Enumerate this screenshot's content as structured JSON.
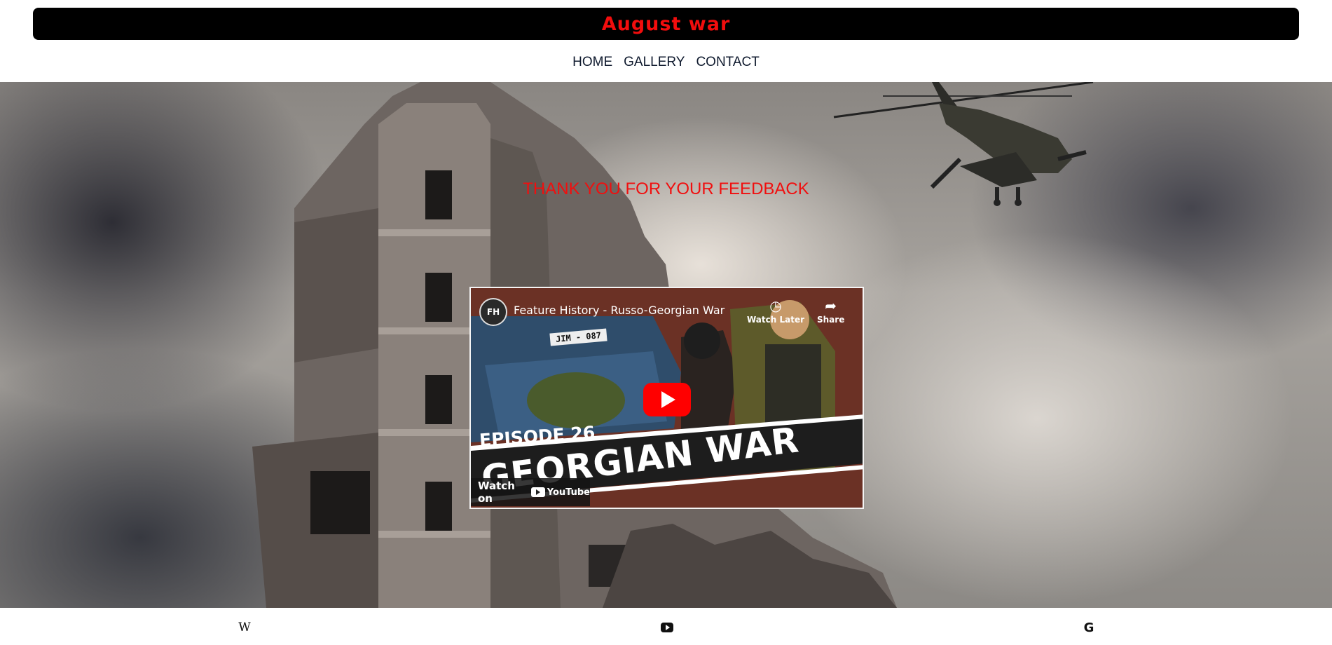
{
  "header": {
    "title": "August war"
  },
  "nav": {
    "items": [
      "HOME",
      "GALLERY",
      "CONTACT"
    ]
  },
  "main": {
    "feedback": "THANK YOU FOR YOUR FEEDBACK"
  },
  "video": {
    "title": "Feature History - Russo-Georgian War",
    "channel_badge": "FH",
    "watch_later": "Watch Later",
    "share": "Share",
    "plate": "JIM - 087",
    "episode": "EPISODE 26",
    "banner": "GEORGIAN WAR",
    "watch_on": "Watch on",
    "youtube": "YouTube"
  },
  "footer": {
    "wiki_glyph": "W",
    "google_glyph": "G",
    "icons": [
      "wikipedia-icon",
      "youtube-icon",
      "google-icon"
    ]
  },
  "colors": {
    "title_red": "#f20d0d",
    "feedback_red": "#f00f0f",
    "title_bar_bg": "#000000"
  }
}
